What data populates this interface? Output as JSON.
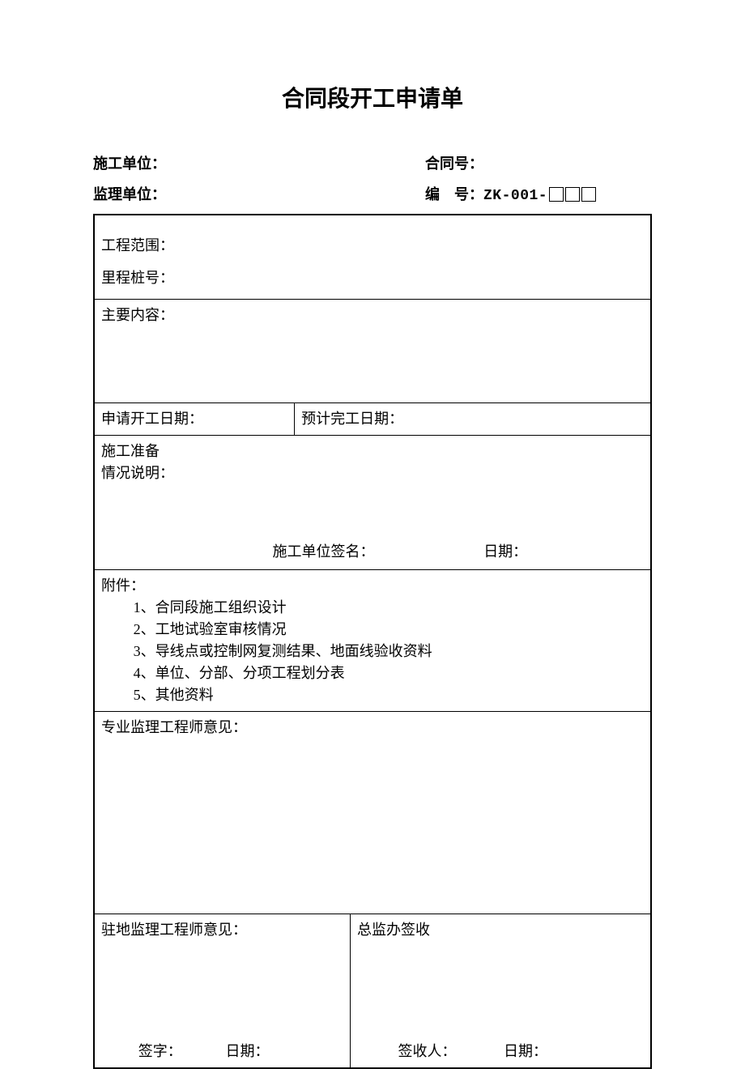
{
  "title": "合同段开工申请单",
  "header": {
    "construction_unit_label": "施工单位：",
    "contract_no_label": "合同号：",
    "supervision_unit_label": "监理单位：",
    "serial_label": "编　号：",
    "serial_value": "ZK-001-"
  },
  "form": {
    "range_label": "工程范围：",
    "mileage_label": "里程桩号：",
    "main_content_label": "主要内容：",
    "apply_date_label": "申请开工日期：",
    "expect_date_label": "预计完工日期：",
    "prep_line1": "施工准备",
    "prep_line2": "情况说明：",
    "prep_sign_label": "施工单位签名：",
    "prep_date_label": "日期：",
    "attach_label": "附件：",
    "attach_items": [
      "1、合同段施工组织设计",
      "2、工地试验室审核情况",
      "3、导线点或控制网复测结果、地面线验收资料",
      "4、单位、分部、分项工程划分表",
      "5、其他资料"
    ],
    "se_opinion_label": "专业监理工程师意见：",
    "re_opinion_label": "驻地监理工程师意见：",
    "chief_sign_label": "总监办签收",
    "re_sign_label": "签字：",
    "re_date_label": "日期：",
    "chief_signer_label": "签收人：",
    "chief_date_label": "日期："
  }
}
